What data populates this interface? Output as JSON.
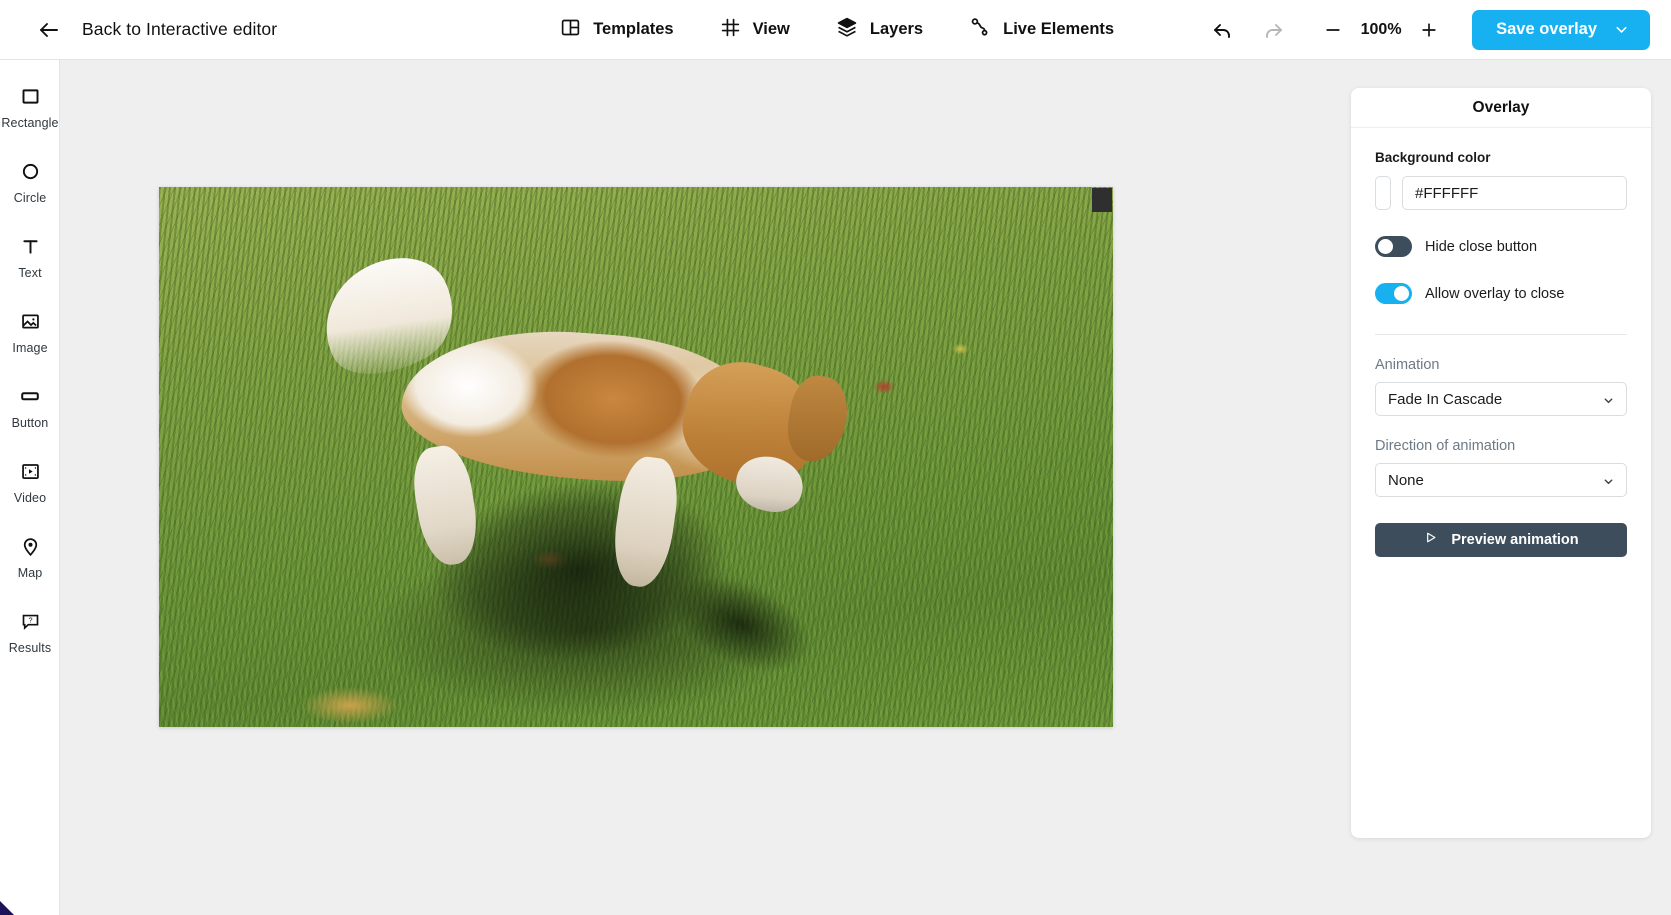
{
  "topbar": {
    "back_icon": "arrow-left-icon",
    "back_label": "Back to Interactive editor",
    "nav": [
      {
        "icon": "templates-icon",
        "label": "Templates"
      },
      {
        "icon": "grid-view-icon",
        "label": "View"
      },
      {
        "icon": "layers-icon",
        "label": "Layers"
      },
      {
        "icon": "live-elements-icon",
        "label": "Live Elements"
      }
    ],
    "undo_icon": "undo-arrow-icon",
    "redo_icon": "redo-arrow-icon",
    "zoom_out_label": "−",
    "zoom_level": "100%",
    "zoom_in_label": "+",
    "save_label": "Save overlay",
    "save_caret_icon": "chevron-down-icon",
    "accent_color": "#17b0f0"
  },
  "sidebar": {
    "items": [
      {
        "icon": "rectangle-icon",
        "label": "Rectangle"
      },
      {
        "icon": "circle-icon",
        "label": "Circle"
      },
      {
        "icon": "text-icon",
        "label": "Text"
      },
      {
        "icon": "image-icon",
        "label": "Image"
      },
      {
        "icon": "button-icon",
        "label": "Button"
      },
      {
        "icon": "video-icon",
        "label": "Video"
      },
      {
        "icon": "map-pin-icon",
        "label": "Map"
      },
      {
        "icon": "results-bubble-icon",
        "label": "Results"
      }
    ]
  },
  "canvas": {
    "artboard_name": "overlay-artboard",
    "media_name": "dog-on-grass-video",
    "close_chip_name": "overlay-close-button"
  },
  "panel": {
    "title": "Overlay",
    "background_color": {
      "label": "Background color",
      "value": "#FFFFFF",
      "swatch": "#FFFFFF"
    },
    "toggles": [
      {
        "label": "Hide close button",
        "state": "off",
        "color": "#3d4d5c"
      },
      {
        "label": "Allow overlay to close",
        "state": "on",
        "color": "#17b0f0"
      }
    ],
    "animation": {
      "label": "Animation",
      "value": "Fade In Cascade",
      "caret_icon": "chevron-down-icon"
    },
    "direction": {
      "label": "Direction of animation",
      "value": "None",
      "caret_icon": "chevron-down-icon"
    },
    "preview": {
      "icon": "play-triangle-icon",
      "label": "Preview animation",
      "color": "#3d4d5c"
    }
  }
}
